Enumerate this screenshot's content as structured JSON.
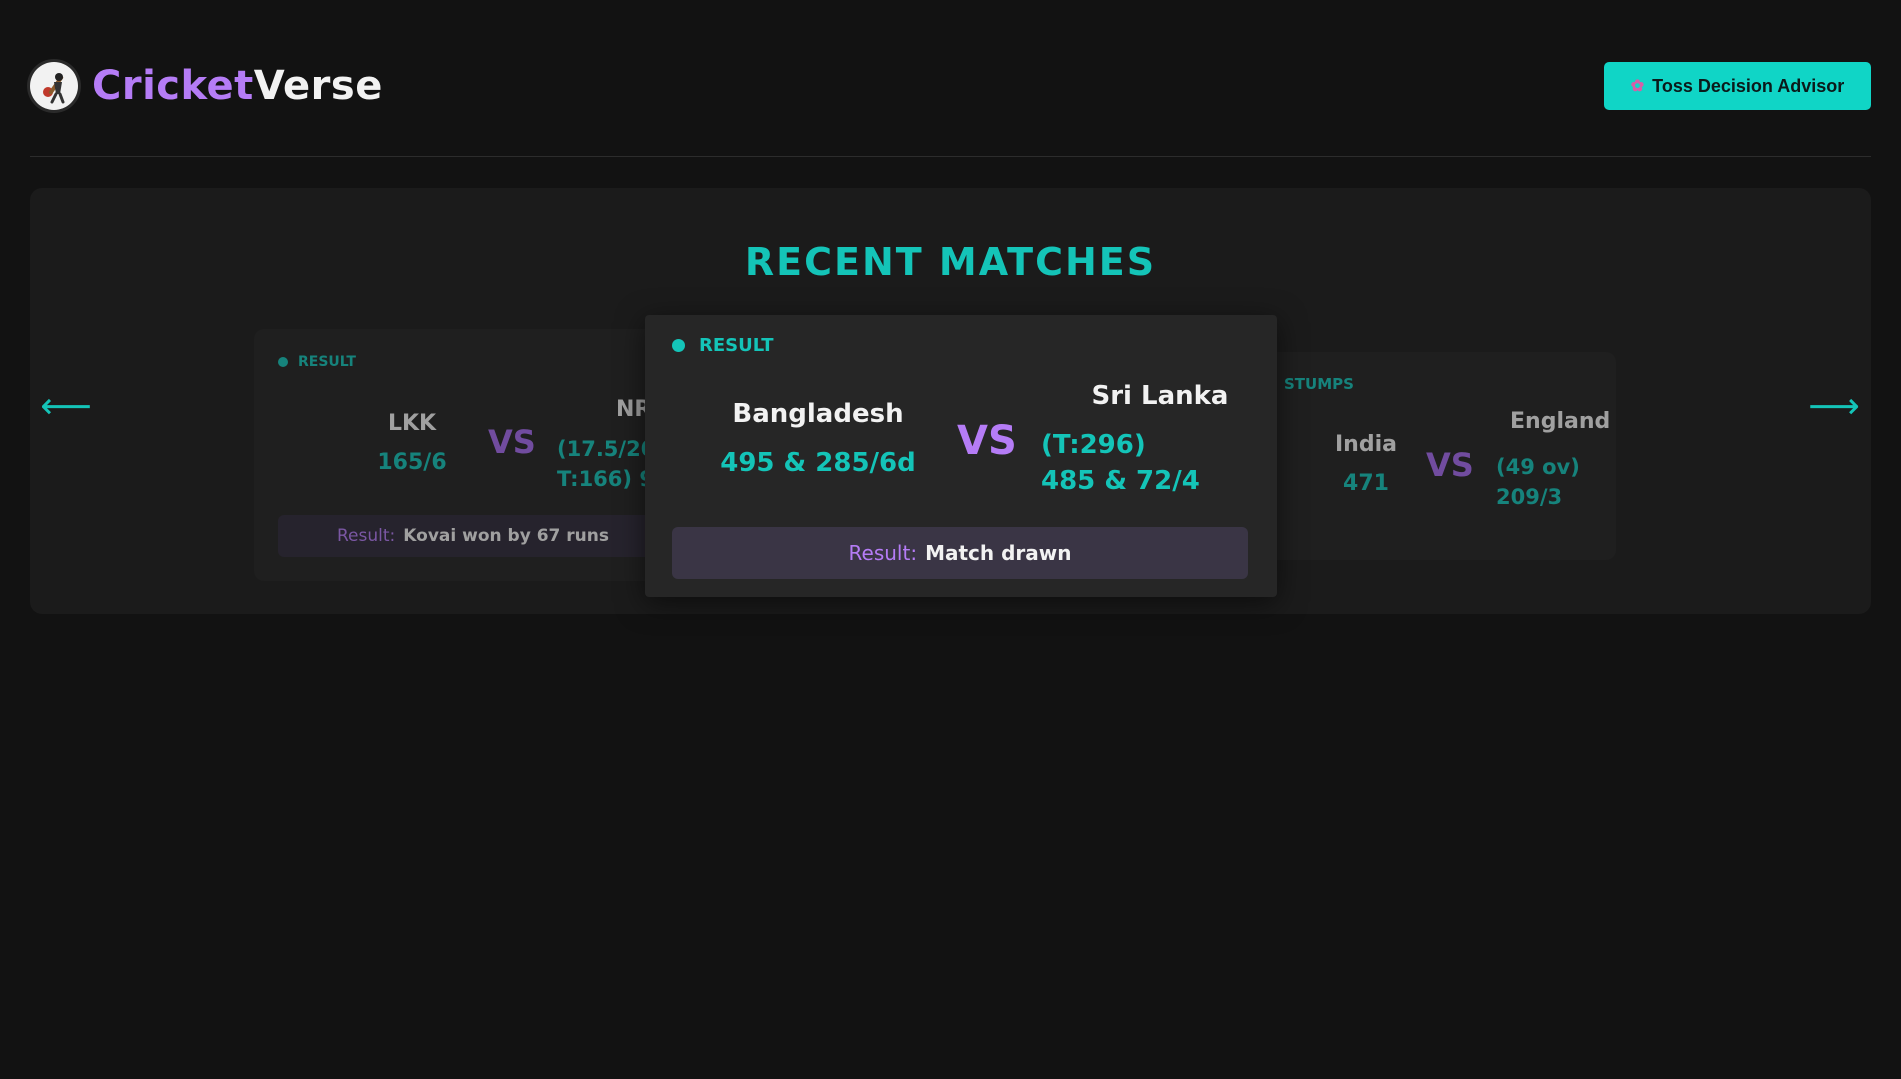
{
  "app": {
    "name_part1": "Cricket",
    "name_part2": "Verse",
    "logo_icon": "cricket-player-icon"
  },
  "header": {
    "toss_button": {
      "icon": "brain-icon",
      "label": "Toss Decision Advisor"
    }
  },
  "section": {
    "title": "RECENT MATCHES"
  },
  "carousel": {
    "prev_icon": "arrow-left-icon",
    "next_icon": "arrow-right-icon",
    "cards": [
      {
        "status": "RESULT",
        "team1": {
          "name": "LKK",
          "score": "165/6"
        },
        "vs": "VS",
        "team2": {
          "name": "NR",
          "score_line1": "(17.5/20",
          "score_line2": "T:166) 9"
        },
        "result_label": "Result:",
        "result_value": "Kovai won by 67 runs"
      },
      {
        "status": "RESULT",
        "team1": {
          "name": "Bangladesh",
          "score": "495 & 285/6d"
        },
        "vs": "VS",
        "team2": {
          "name": "Sri Lanka",
          "score_line1": "(T:296)",
          "score_line2": "485 & 72/4"
        },
        "result_label": "Result:",
        "result_value": "Match drawn"
      },
      {
        "status": "STUMPS",
        "team1": {
          "name": "India",
          "score": "471"
        },
        "vs": "VS",
        "team2": {
          "name": "England",
          "score_line1": "(49 ov)",
          "score_line2": "209/3"
        }
      }
    ]
  },
  "colors": {
    "accent_teal": "#14c4b8",
    "accent_purple": "#b57cf6",
    "background": "#121212",
    "panel": "#1b1b1b"
  }
}
